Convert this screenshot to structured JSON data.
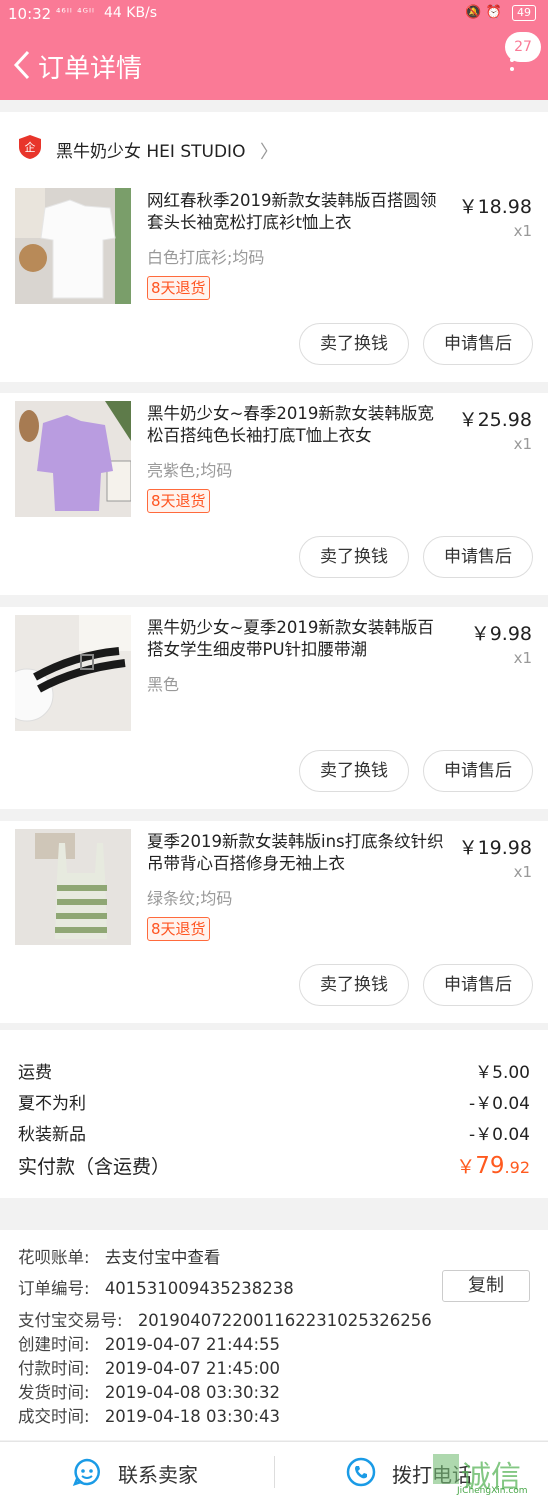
{
  "status_bar": {
    "time": "10:32",
    "signal": "⁴⁶ᴵˡ ⁴ᴳᴵˡ",
    "speed": "44 KB/s",
    "battery": "49"
  },
  "header": {
    "title": "订单详情",
    "badge_count": "27"
  },
  "shop": {
    "name": "黑牛奶少女 HEI STUDIO"
  },
  "items": [
    {
      "title": "网红春秋季2019新款女装韩版百搭圆领套头长袖宽松打底衫t恤上衣",
      "price": "￥18.98",
      "qty": "x1",
      "sku": "白色打底衫;均码",
      "tag": "8天退货",
      "btn_exchange": "卖了换钱",
      "btn_aftersale": "申请售后"
    },
    {
      "title": "黑牛奶少女~春季2019新款女装韩版宽松百搭纯色长袖打底T恤上衣女",
      "price": "￥25.98",
      "qty": "x1",
      "sku": "亮紫色;均码",
      "tag": "8天退货",
      "btn_exchange": "卖了换钱",
      "btn_aftersale": "申请售后"
    },
    {
      "title": "黑牛奶少女~夏季2019新款女装韩版百搭女学生细皮带PU针扣腰带潮",
      "price": "￥9.98",
      "qty": "x1",
      "sku": "黑色",
      "tag": "",
      "btn_exchange": "卖了换钱",
      "btn_aftersale": "申请售后"
    },
    {
      "title": "夏季2019新款女装韩版ins打底条纹针织吊带背心百搭修身无袖上衣",
      "price": "￥19.98",
      "qty": "x1",
      "sku": "绿条纹;均码",
      "tag": "8天退货",
      "btn_exchange": "卖了换钱",
      "btn_aftersale": "申请售后"
    }
  ],
  "costs": {
    "shipping_label": "运费",
    "shipping_value": "￥5.00",
    "discount1_label": "夏不为利",
    "discount1_value": "-￥0.04",
    "discount2_label": "秋装新品",
    "discount2_value": "-￥0.04",
    "total_label": "实付款（含运费）",
    "total_currency": "￥",
    "total_int": "79",
    "total_dec": ".92"
  },
  "order_info": {
    "huabei_label": "花呗账单:",
    "huabei_value": "去支付宝中查看",
    "order_no_label": "订单编号:",
    "order_no_value": "401531009435238238",
    "copy_label": "复制",
    "alipay_label": "支付宝交易号:",
    "alipay_value": "2019040722001162231025326256",
    "created_label": "创建时间:",
    "created_value": "2019-04-07 21:44:55",
    "paid_label": "付款时间:",
    "paid_value": "2019-04-07 21:45:00",
    "shipped_label": "发货时间:",
    "shipped_value": "2019-04-08 03:30:32",
    "completed_label": "成交时间:",
    "completed_value": "2019-04-18 03:30:43"
  },
  "bottom": {
    "contact_label": "联系卖家",
    "call_label": "拨打电话"
  },
  "watermark": {
    "text": "诚信",
    "url": "JiChengXin.com"
  },
  "colors": {
    "header": "#fa7a96",
    "price_accent": "#ff5a1f",
    "tag_orange": "#ff5522",
    "icon_blue": "#1a9be6"
  }
}
